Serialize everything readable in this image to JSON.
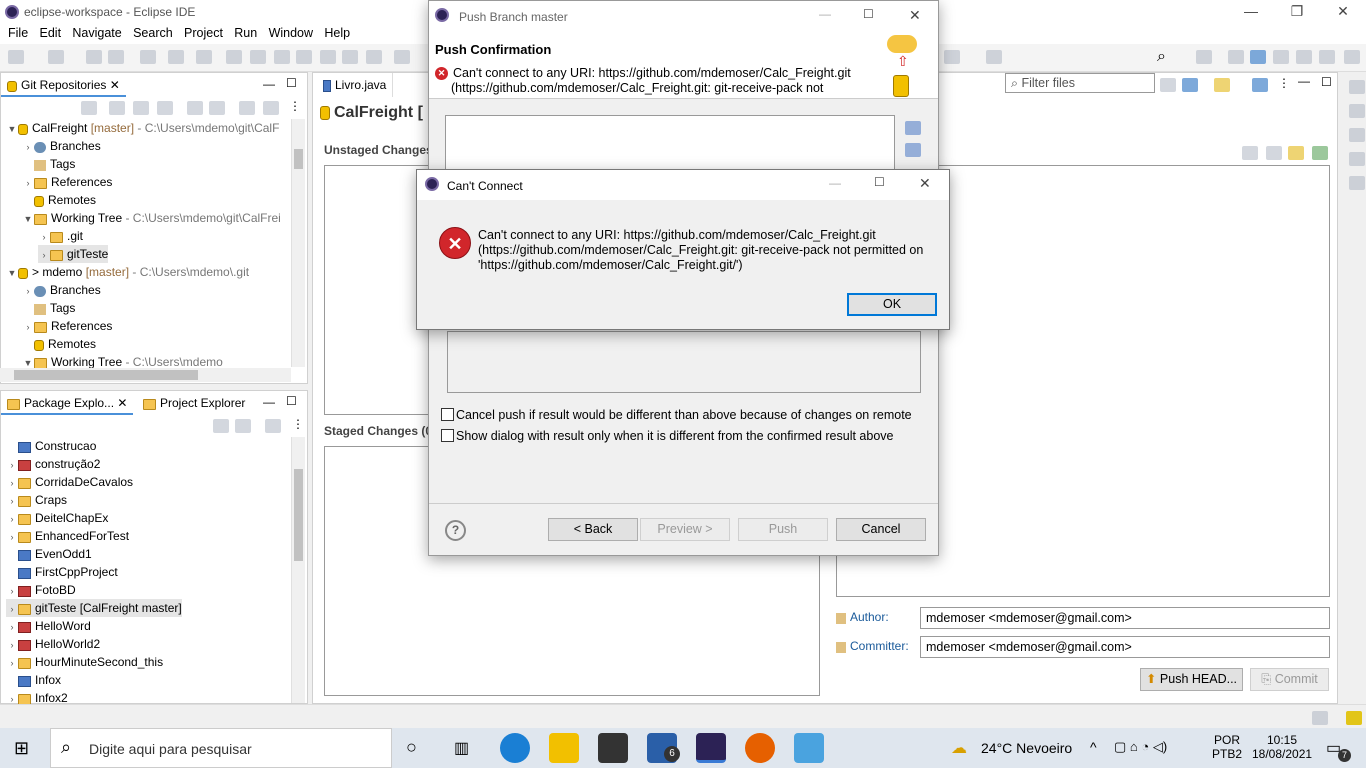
{
  "window": {
    "title": "eclipse-workspace - Eclipse IDE"
  },
  "menu": [
    "File",
    "Edit",
    "Navigate",
    "Search",
    "Project",
    "Run",
    "Window",
    "Help"
  ],
  "git_repos": {
    "tab_label": "Git Repositories",
    "rows": [
      {
        "label": "CalFreight",
        "extra": " [master]",
        "path": " - C:\\Users\\mdemo\\git\\CalF"
      },
      {
        "label": "Branches"
      },
      {
        "label": "Tags"
      },
      {
        "label": "References"
      },
      {
        "label": "Remotes"
      },
      {
        "label": "Working Tree",
        "path": " - C:\\Users\\mdemo\\git\\CalFrei"
      },
      {
        "label": ".git"
      },
      {
        "label": "gitTeste"
      },
      {
        "label": "> mdemo",
        "extra": " [master]",
        "path": " - C:\\Users\\mdemo\\.git"
      },
      {
        "label": "Branches"
      },
      {
        "label": "Tags"
      },
      {
        "label": "References"
      },
      {
        "label": "Remotes"
      },
      {
        "label": "Working Tree",
        "path": " - C:\\Users\\mdemo"
      }
    ]
  },
  "package_explorer": {
    "tab_label": "Package Explo...",
    "tab2_label": "Project Explorer",
    "items": [
      "Construcao",
      "construção2",
      "CorridaDeCavalos",
      "Craps",
      "DeitelChapEx",
      "EnhancedForTest",
      "EvenOdd1",
      "FirstCppProject",
      "FotoBD",
      "gitTeste [CalFreight master]",
      "HelloWord",
      "HelloWorld2",
      "HourMinuteSecond_this",
      "Infox",
      "Infox2"
    ]
  },
  "editor": {
    "tab_label": "Livro.java",
    "staging_title": "CalFreight [",
    "unstaged_label": "Unstaged Changes",
    "staged_label": "Staged Changes (0)",
    "filter_placeholder": "Filter files",
    "author_label": "Author:",
    "author_value": "mdemoser <mdemoser@gmail.com>",
    "committer_label": "Committer:",
    "committer_value": "mdemoser <mdemoser@gmail.com>",
    "push_head_label": "Push HEAD...",
    "commit_label": "Commit"
  },
  "push_dialog": {
    "title": "Push Branch master",
    "heading": "Push Confirmation",
    "error_line1": "Can't connect to any URI: https://github.com/mdemoser/Calc_Freight.git",
    "error_line2": "(https://github.com/mdemoser/Calc_Freight.git: git-receive-pack not",
    "cancel_push_label": "Cancel push if result would be different than above because of changes on remote",
    "show_dialog_label": "Show dialog with result only when it is different from the confirmed result above",
    "back_label": "< Back",
    "preview_label": "Preview >",
    "push_label": "Push",
    "cancel_label": "Cancel",
    "help_glyph": "?"
  },
  "cant_connect": {
    "title": "Can't Connect",
    "message_line1": "Can't connect to any URI: https://github.com/mdemoser/Calc_Freight.git",
    "message_line2": "(https://github.com/mdemoser/Calc_Freight.git: git-receive-pack not permitted on",
    "message_line3": "'https://github.com/mdemoser/Calc_Freight.git/')",
    "ok_label": "OK"
  },
  "taskbar": {
    "search_placeholder": "Digite aqui para pesquisar",
    "mail_badge": "6",
    "weather": "24°C  Nevoeiro",
    "lang_line1": "POR",
    "lang_line2": "PTB2",
    "time": "10:15",
    "date": "18/08/2021",
    "notif_count": "7"
  }
}
